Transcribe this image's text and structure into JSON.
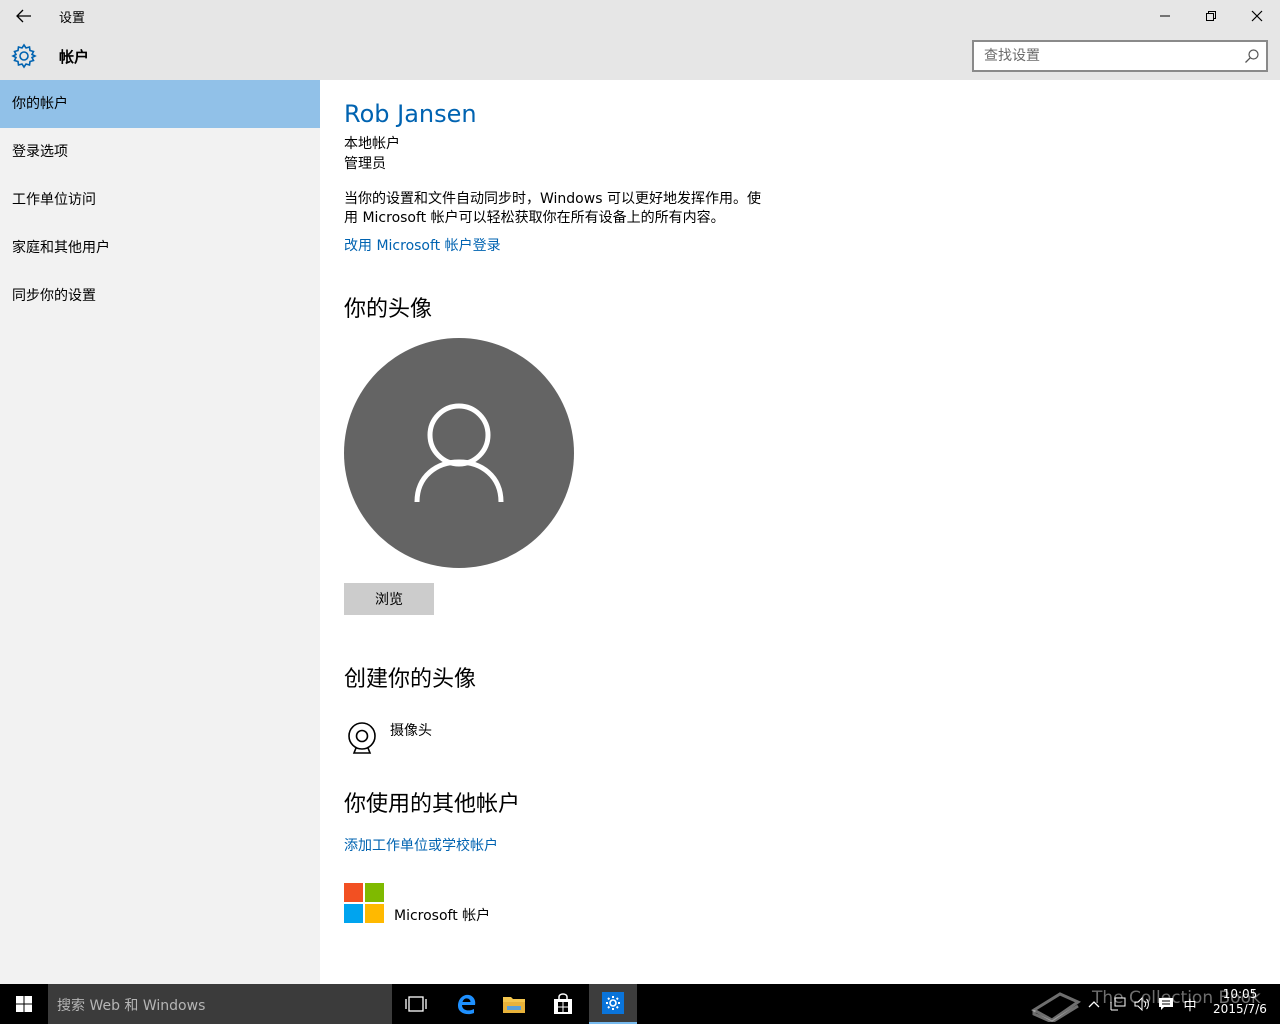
{
  "window": {
    "title": "设置"
  },
  "header": {
    "title": "帐户",
    "search_placeholder": "查找设置"
  },
  "sidebar": {
    "items": [
      {
        "label": "你的帐户",
        "active": true
      },
      {
        "label": "登录选项",
        "active": false
      },
      {
        "label": "工作单位访问",
        "active": false
      },
      {
        "label": "家庭和其他用户",
        "active": false
      },
      {
        "label": "同步你的设置",
        "active": false
      }
    ]
  },
  "account": {
    "name": "Rob Jansen",
    "type": "本地帐户",
    "role": "管理员",
    "description_line1": "当你的设置和文件自动同步时，Windows 可以更好地发挥作用。使",
    "description_line2": "用 Microsoft 帐户可以轻松获取你在所有设备上的所有内容。",
    "switch_link": "改用 Microsoft 帐户登录"
  },
  "avatar_section": {
    "title": "你的头像",
    "browse_label": "浏览"
  },
  "create_section": {
    "title": "创建你的头像",
    "camera_label": "摄像头"
  },
  "other_accounts": {
    "title": "你使用的其他帐户",
    "add_link": "添加工作单位或学校帐户",
    "ms_account_label": "Microsoft 帐户"
  },
  "taskbar": {
    "search_text": "搜索 Web 和 Windows",
    "time": "10:05",
    "date": "2015/7/6",
    "ime": "中",
    "watermark": "The Collection Book"
  },
  "colors": {
    "accent": "#0063b1",
    "sidebar_active": "#91c1e8",
    "avatar_bg": "#646464",
    "ms_red": "#f25022",
    "ms_green": "#7fba00",
    "ms_blue": "#00a4ef",
    "ms_yellow": "#ffb900"
  }
}
